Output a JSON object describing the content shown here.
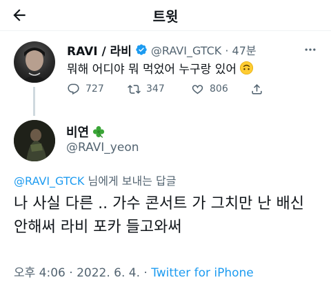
{
  "header": {
    "title": "트윗",
    "back_icon": "arrow-left-icon"
  },
  "parent_tweet": {
    "display_name": "RAVI / 라비",
    "verified_icon": "verified-badge-icon",
    "handle_time": "@RAVI_GTCK · 47분",
    "text": "뭐해 어디야 뭐 먹었어 누구랑 있어",
    "emoji_icon": "upside-down-face-emoji",
    "actions": {
      "reply_count": "727",
      "retweet_count": "347",
      "like_count": "806"
    }
  },
  "reply_tweet": {
    "display_name": "비연",
    "name_emoji": "four-leaf-clover-icon",
    "handle": "@RAVI_yeon",
    "replying_to": "@RAVI_GTCK",
    "replying_suffix": " 님에게 보내는 답글",
    "text": "나 사실 다른 .. 가수 콘서트 가 그치만 난 배신 안해써 라비 포카 들고와써",
    "timestamp": "오후 4:06 · 2022. 6. 4. · ",
    "source": "Twitter for iPhone"
  },
  "colors": {
    "accent": "#1d9bf0",
    "muted": "#536471",
    "text": "#0f1419",
    "line": "#cfd9de"
  }
}
